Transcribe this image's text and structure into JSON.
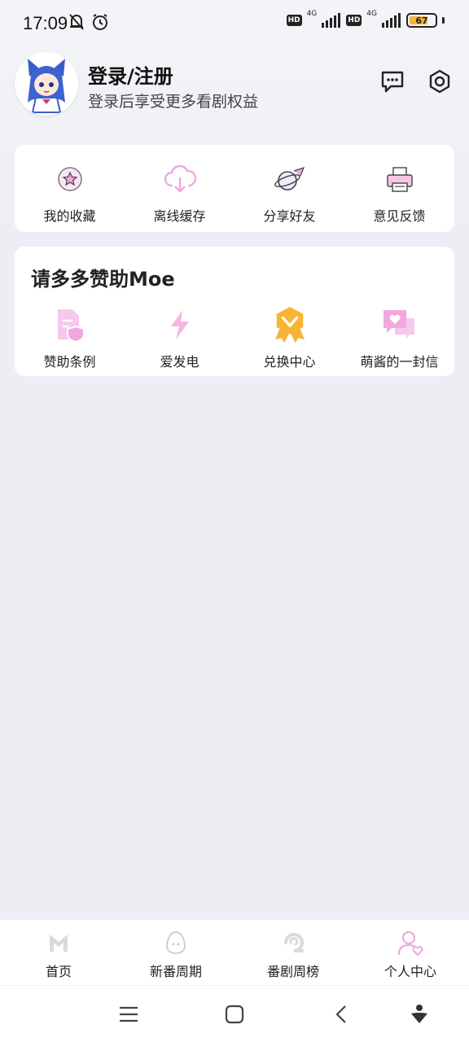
{
  "status_bar": {
    "time": "17:09",
    "battery": "67",
    "network_1": "4G",
    "network_2": "4G",
    "hd": "HD"
  },
  "profile": {
    "title": "登录/注册",
    "subtitle": "登录后享受更多看剧权益"
  },
  "quick_actions": [
    {
      "label": "我的收藏",
      "icon": "favorites-star-icon"
    },
    {
      "label": "离线缓存",
      "icon": "cloud-download-icon"
    },
    {
      "label": "分享好友",
      "icon": "share-planet-icon"
    },
    {
      "label": "意见反馈",
      "icon": "feedback-printer-icon"
    }
  ],
  "sponsor": {
    "title": "请多多赞助Moe",
    "items": [
      {
        "label": "赞助条例",
        "icon": "document-shield-icon"
      },
      {
        "label": "爱发电",
        "icon": "lightning-icon"
      },
      {
        "label": "兑换中心",
        "icon": "medal-badge-icon"
      },
      {
        "label": "萌酱的一封信",
        "icon": "chat-heart-icon"
      }
    ]
  },
  "bottom_nav": [
    {
      "label": "首页",
      "icon": "home-m-icon"
    },
    {
      "label": "新番周期",
      "icon": "egg-icon"
    },
    {
      "label": "番剧周榜",
      "icon": "e-swirl-icon"
    },
    {
      "label": "个人中心",
      "icon": "user-heart-icon"
    }
  ],
  "colors": {
    "accent_pink": "#f0a8de",
    "medal_gold": "#f5b43a",
    "background": "#eceef4"
  }
}
